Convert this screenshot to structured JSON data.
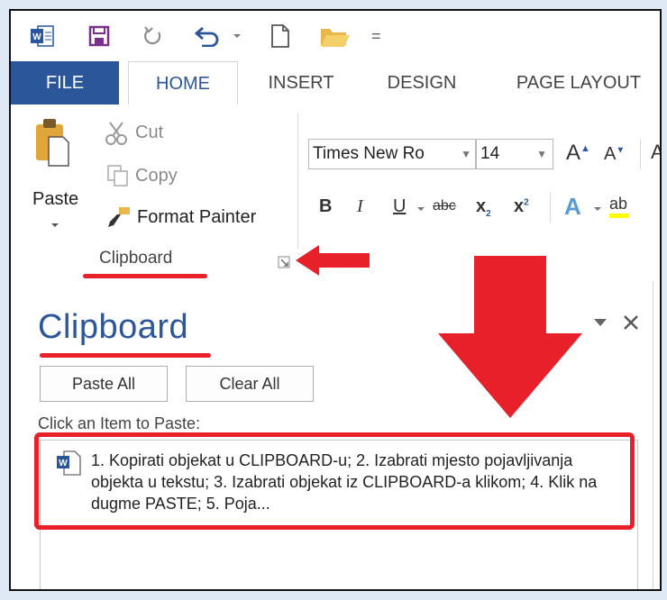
{
  "app": {
    "name": "Microsoft Word"
  },
  "quick_access": {
    "icons": [
      "word-app-icon",
      "save-icon",
      "repeat-icon",
      "undo-icon",
      "new-document-icon",
      "open-folder-icon",
      "customize-qat-icon"
    ],
    "overflow_glyph": "="
  },
  "tabs": [
    {
      "label": "FILE"
    },
    {
      "label": "HOME"
    },
    {
      "label": "INSERT"
    },
    {
      "label": "DESIGN"
    },
    {
      "label": "PAGE LAYOUT"
    }
  ],
  "ribbon": {
    "clipboard": {
      "paste_label": "Paste",
      "cut_label": "Cut",
      "copy_label": "Copy",
      "format_painter_label": "Format Painter",
      "group_label": "Clipboard"
    },
    "font": {
      "font_name": "Times New Ro",
      "font_size": "14",
      "grow_label": "A",
      "shrink_label": "A",
      "case_label": "A",
      "bold": "B",
      "italic": "I",
      "underline": "U",
      "strike": "abc",
      "subscript": "x",
      "superscript": "x",
      "text_effects": "A",
      "highlight": "ab"
    }
  },
  "pane": {
    "title": "Clipboard",
    "paste_all_label": "Paste All",
    "clear_all_label": "Clear All",
    "hint": "Click an Item to Paste:",
    "items": [
      {
        "text": "1. Kopirati objekat u CLIPBOARD-u; 2. Izabrati mjesto pojavljivanja objekta u tekstu; 3. Izabrati objekat iz CLIPBOARD-a klikom; 4. Klik na dugme PASTE; 5. Poja..."
      }
    ]
  },
  "colors": {
    "word_blue": "#2b579a",
    "annotation_red": "#e8202a"
  }
}
